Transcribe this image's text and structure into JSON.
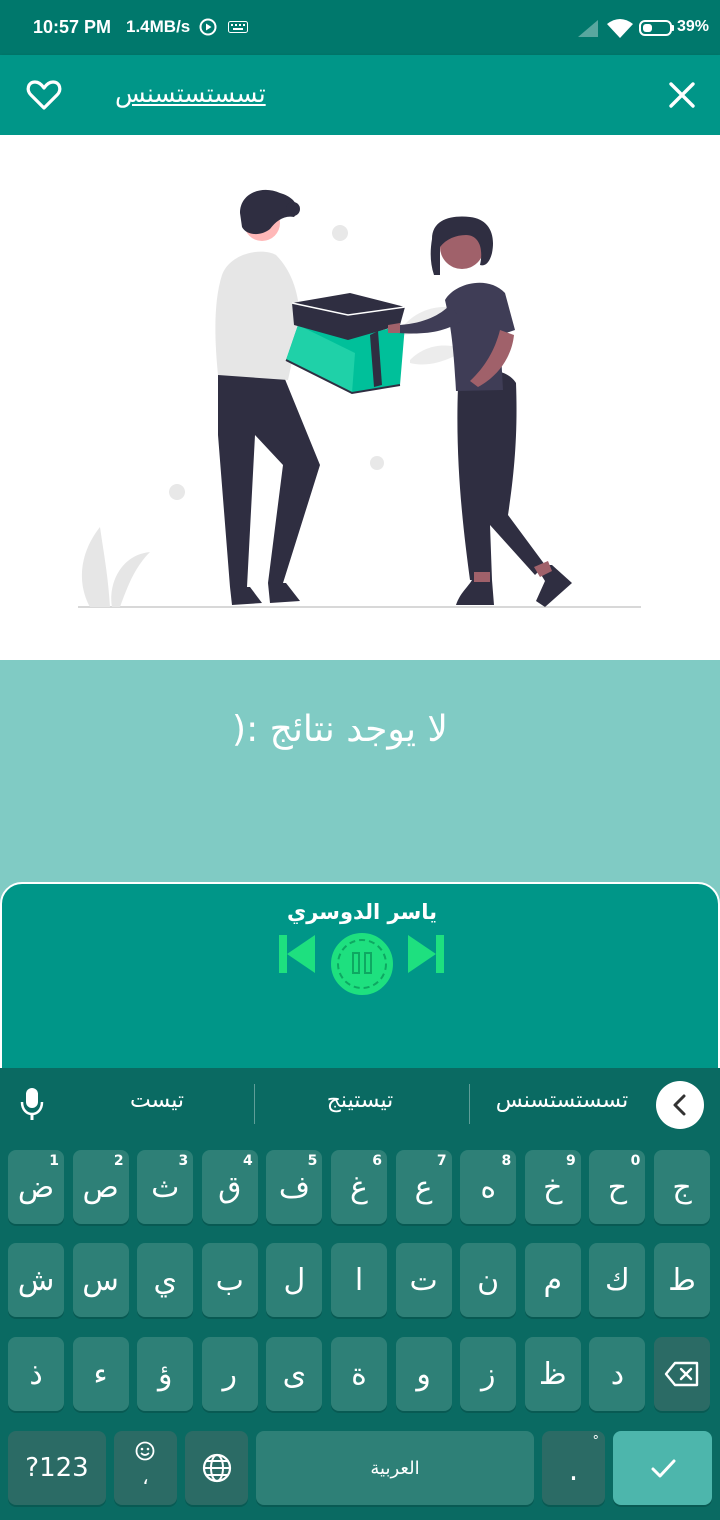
{
  "status_bar": {
    "time": "10:57 PM",
    "speed": "1.4MB/s",
    "battery": "39%"
  },
  "app_bar": {
    "title": "تسستستسنس",
    "favorite_icon": "heart-outline-icon",
    "close_icon": "close-icon"
  },
  "results": {
    "empty_message": "): لا يوجد نتائج"
  },
  "player": {
    "reciter": "ياسر الدوسري",
    "accent": "#1ee07f"
  },
  "keyboard": {
    "suggestions": [
      "تيست",
      "تيستينج",
      "تسستستسنس"
    ],
    "row1": [
      {
        "ch": "ض",
        "n": "1"
      },
      {
        "ch": "ص",
        "n": "2"
      },
      {
        "ch": "ث",
        "n": "3"
      },
      {
        "ch": "ق",
        "n": "4"
      },
      {
        "ch": "ف",
        "n": "5"
      },
      {
        "ch": "غ",
        "n": "6"
      },
      {
        "ch": "ع",
        "n": "7"
      },
      {
        "ch": "ه",
        "n": "8"
      },
      {
        "ch": "خ",
        "n": "9"
      },
      {
        "ch": "ح",
        "n": "0"
      },
      {
        "ch": "ج",
        "n": ""
      }
    ],
    "row2": [
      "ش",
      "س",
      "ي",
      "ب",
      "ل",
      "ا",
      "ت",
      "ن",
      "م",
      "ك",
      "ط"
    ],
    "row3": [
      "ذ",
      "ء",
      "ؤ",
      "ر",
      "ى",
      "ة",
      "و",
      "ز",
      "ظ",
      "د"
    ],
    "symbols_label": "?123",
    "emoji_sub": "،",
    "space_label": "العربية",
    "period": ".",
    "colors": {
      "key": "#2e8077",
      "bg": "#0a6a62",
      "enter": "#4db6ac"
    }
  }
}
